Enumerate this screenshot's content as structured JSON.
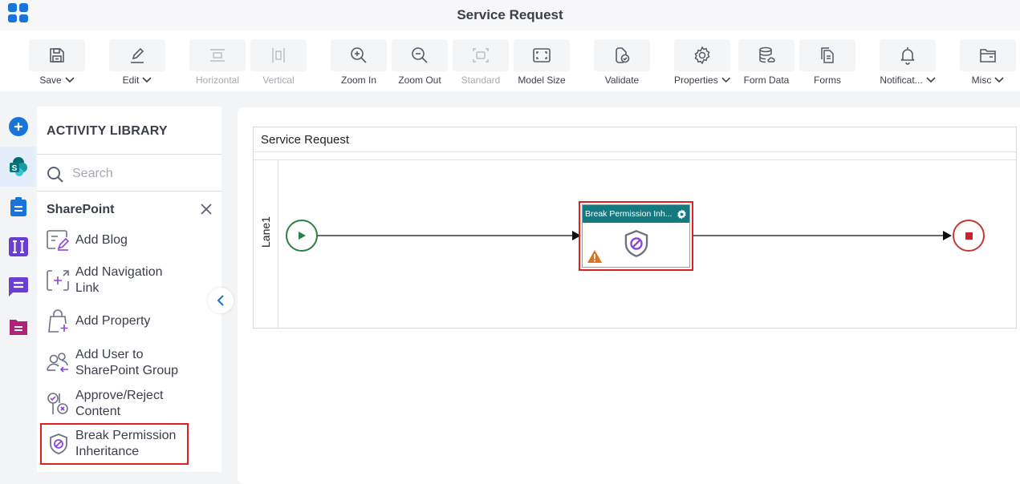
{
  "header": {
    "title": "Service Request",
    "app_menu_icon": "apps-grid-icon"
  },
  "toolbar": {
    "buttons": [
      {
        "id": "save",
        "label": "Save",
        "icon": "save-icon",
        "dropdown": true,
        "disabled": false
      },
      {
        "id": "edit",
        "label": "Edit",
        "icon": "pencil-icon",
        "dropdown": true,
        "disabled": false
      },
      {
        "id": "horizontal",
        "label": "Horizontal",
        "icon": "horizontal-layout-icon",
        "dropdown": false,
        "disabled": true
      },
      {
        "id": "vertical",
        "label": "Vertical",
        "icon": "vertical-layout-icon",
        "dropdown": false,
        "disabled": true
      },
      {
        "id": "zoom-in",
        "label": "Zoom In",
        "icon": "zoom-in-icon",
        "dropdown": false,
        "disabled": false
      },
      {
        "id": "zoom-out",
        "label": "Zoom Out",
        "icon": "zoom-out-icon",
        "dropdown": false,
        "disabled": false
      },
      {
        "id": "standard",
        "label": "Standard",
        "icon": "standard-size-icon",
        "dropdown": false,
        "disabled": true
      },
      {
        "id": "model-size",
        "label": "Model Size",
        "icon": "model-size-icon",
        "dropdown": false,
        "disabled": false
      },
      {
        "id": "validate",
        "label": "Validate",
        "icon": "validate-icon",
        "dropdown": false,
        "disabled": false
      },
      {
        "id": "properties",
        "label": "Properties",
        "icon": "gear-icon",
        "dropdown": true,
        "disabled": false
      },
      {
        "id": "form-data",
        "label": "Form Data",
        "icon": "database-icon",
        "dropdown": false,
        "disabled": false
      },
      {
        "id": "forms",
        "label": "Forms",
        "icon": "forms-icon",
        "dropdown": false,
        "disabled": false
      },
      {
        "id": "notifications",
        "label": "Notificat...",
        "icon": "bell-icon",
        "dropdown": true,
        "disabled": false
      },
      {
        "id": "misc",
        "label": "Misc",
        "icon": "folder-icon",
        "dropdown": true,
        "disabled": false
      }
    ]
  },
  "icon_rail": {
    "items": [
      {
        "name": "add",
        "icon": "plus-circle-icon",
        "color": "#1a73d9"
      },
      {
        "name": "sharepoint",
        "icon": "sharepoint-icon",
        "active": true
      },
      {
        "name": "forms",
        "icon": "clipboard-icon",
        "color": "#1a73d9"
      },
      {
        "name": "text",
        "icon": "text-field-icon",
        "color": "#6a3fd0"
      },
      {
        "name": "messages",
        "icon": "chat-icon",
        "color": "#6a3fd0"
      },
      {
        "name": "documents",
        "icon": "folder-doc-icon",
        "color": "#b0237a"
      }
    ]
  },
  "library": {
    "title": "ACTIVITY LIBRARY",
    "search": {
      "placeholder": "Search",
      "value": ""
    },
    "category": "SharePoint",
    "items": [
      {
        "label": "Add Blog",
        "icon": "add-blog-icon"
      },
      {
        "label": "Add Navigation Link",
        "icon": "add-navigation-link-icon"
      },
      {
        "label": "Add Property",
        "icon": "add-property-icon"
      },
      {
        "label_line1": "Add User to",
        "label_line2": "SharePoint Group",
        "icon": "add-user-group-icon"
      },
      {
        "label_line1": "Approve/Reject",
        "label_line2": "Content",
        "icon": "approve-reject-icon"
      },
      {
        "label_line1": "Break Permission",
        "label_line2": "Inheritance",
        "icon": "shield-block-icon",
        "selected": true
      }
    ]
  },
  "canvas": {
    "pool_title": "Service Request",
    "lane_label": "Lane1",
    "task": {
      "title": "Break Permission Inh...",
      "has_warning": true
    },
    "colors": {
      "start": "#2e7d46",
      "end": "#c0393b",
      "task_header": "#157a80",
      "selection": "#e02020",
      "warning": "#e07020"
    }
  }
}
